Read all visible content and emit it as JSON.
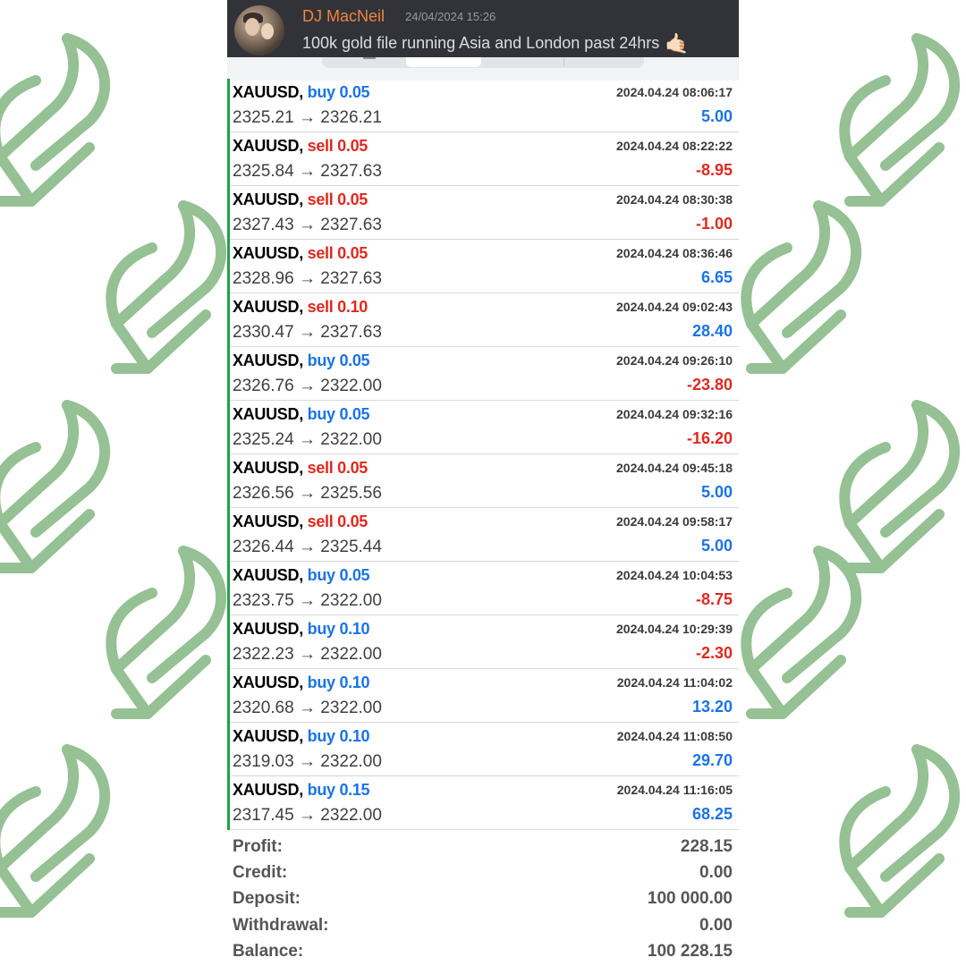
{
  "background": {
    "motif_color": "#95c194",
    "motif_icon": "stylized-leaf-logo-icon"
  },
  "chat": {
    "author": "DJ MacNeil",
    "author_color": "#f0843c",
    "timestamp": "24/04/2024 15:26",
    "message": "100k gold file running Asia and London past 24hrs",
    "emoji": "🤙🏻",
    "avatar_icon": "user-avatar-icon"
  },
  "trades": [
    {
      "symbol": "XAUUSD,",
      "side": "buy",
      "lots": "0.05",
      "open": "2325.21",
      "close": "2326.21",
      "time": "2024.04.24 08:06:17",
      "profit": "5.00",
      "sign": "pos"
    },
    {
      "symbol": "XAUUSD,",
      "side": "sell",
      "lots": "0.05",
      "open": "2325.84",
      "close": "2327.63",
      "time": "2024.04.24 08:22:22",
      "profit": "-8.95",
      "sign": "neg"
    },
    {
      "symbol": "XAUUSD,",
      "side": "sell",
      "lots": "0.05",
      "open": "2327.43",
      "close": "2327.63",
      "time": "2024.04.24 08:30:38",
      "profit": "-1.00",
      "sign": "neg"
    },
    {
      "symbol": "XAUUSD,",
      "side": "sell",
      "lots": "0.05",
      "open": "2328.96",
      "close": "2327.63",
      "time": "2024.04.24 08:36:46",
      "profit": "6.65",
      "sign": "pos"
    },
    {
      "symbol": "XAUUSD,",
      "side": "sell",
      "lots": "0.10",
      "open": "2330.47",
      "close": "2327.63",
      "time": "2024.04.24 09:02:43",
      "profit": "28.40",
      "sign": "pos"
    },
    {
      "symbol": "XAUUSD,",
      "side": "buy",
      "lots": "0.05",
      "open": "2326.76",
      "close": "2322.00",
      "time": "2024.04.24 09:26:10",
      "profit": "-23.80",
      "sign": "neg"
    },
    {
      "symbol": "XAUUSD,",
      "side": "buy",
      "lots": "0.05",
      "open": "2325.24",
      "close": "2322.00",
      "time": "2024.04.24 09:32:16",
      "profit": "-16.20",
      "sign": "neg"
    },
    {
      "symbol": "XAUUSD,",
      "side": "sell",
      "lots": "0.05",
      "open": "2326.56",
      "close": "2325.56",
      "time": "2024.04.24 09:45:18",
      "profit": "5.00",
      "sign": "pos"
    },
    {
      "symbol": "XAUUSD,",
      "side": "sell",
      "lots": "0.05",
      "open": "2326.44",
      "close": "2325.44",
      "time": "2024.04.24 09:58:17",
      "profit": "5.00",
      "sign": "pos"
    },
    {
      "symbol": "XAUUSD,",
      "side": "buy",
      "lots": "0.05",
      "open": "2323.75",
      "close": "2322.00",
      "time": "2024.04.24 10:04:53",
      "profit": "-8.75",
      "sign": "neg"
    },
    {
      "symbol": "XAUUSD,",
      "side": "buy",
      "lots": "0.10",
      "open": "2322.23",
      "close": "2322.00",
      "time": "2024.04.24 10:29:39",
      "profit": "-2.30",
      "sign": "neg"
    },
    {
      "symbol": "XAUUSD,",
      "side": "buy",
      "lots": "0.10",
      "open": "2320.68",
      "close": "2322.00",
      "time": "2024.04.24 11:04:02",
      "profit": "13.20",
      "sign": "pos"
    },
    {
      "symbol": "XAUUSD,",
      "side": "buy",
      "lots": "0.10",
      "open": "2319.03",
      "close": "2322.00",
      "time": "2024.04.24 11:08:50",
      "profit": "29.70",
      "sign": "pos"
    },
    {
      "symbol": "XAUUSD,",
      "side": "buy",
      "lots": "0.15",
      "open": "2317.45",
      "close": "2322.00",
      "time": "2024.04.24 11:16:05",
      "profit": "68.25",
      "sign": "pos"
    }
  ],
  "arrow": "→",
  "summary": [
    {
      "label": "Profit:",
      "value": "228.15"
    },
    {
      "label": "Credit:",
      "value": "0.00"
    },
    {
      "label": "Deposit:",
      "value": "100 000.00"
    },
    {
      "label": "Withdrawal:",
      "value": "0.00"
    },
    {
      "label": "Balance:",
      "value": "100 228.15"
    }
  ],
  "colors": {
    "buy": "#1a73e8",
    "sell": "#e0291f",
    "row_marker": "#24a148",
    "header_bg": "#313338"
  }
}
